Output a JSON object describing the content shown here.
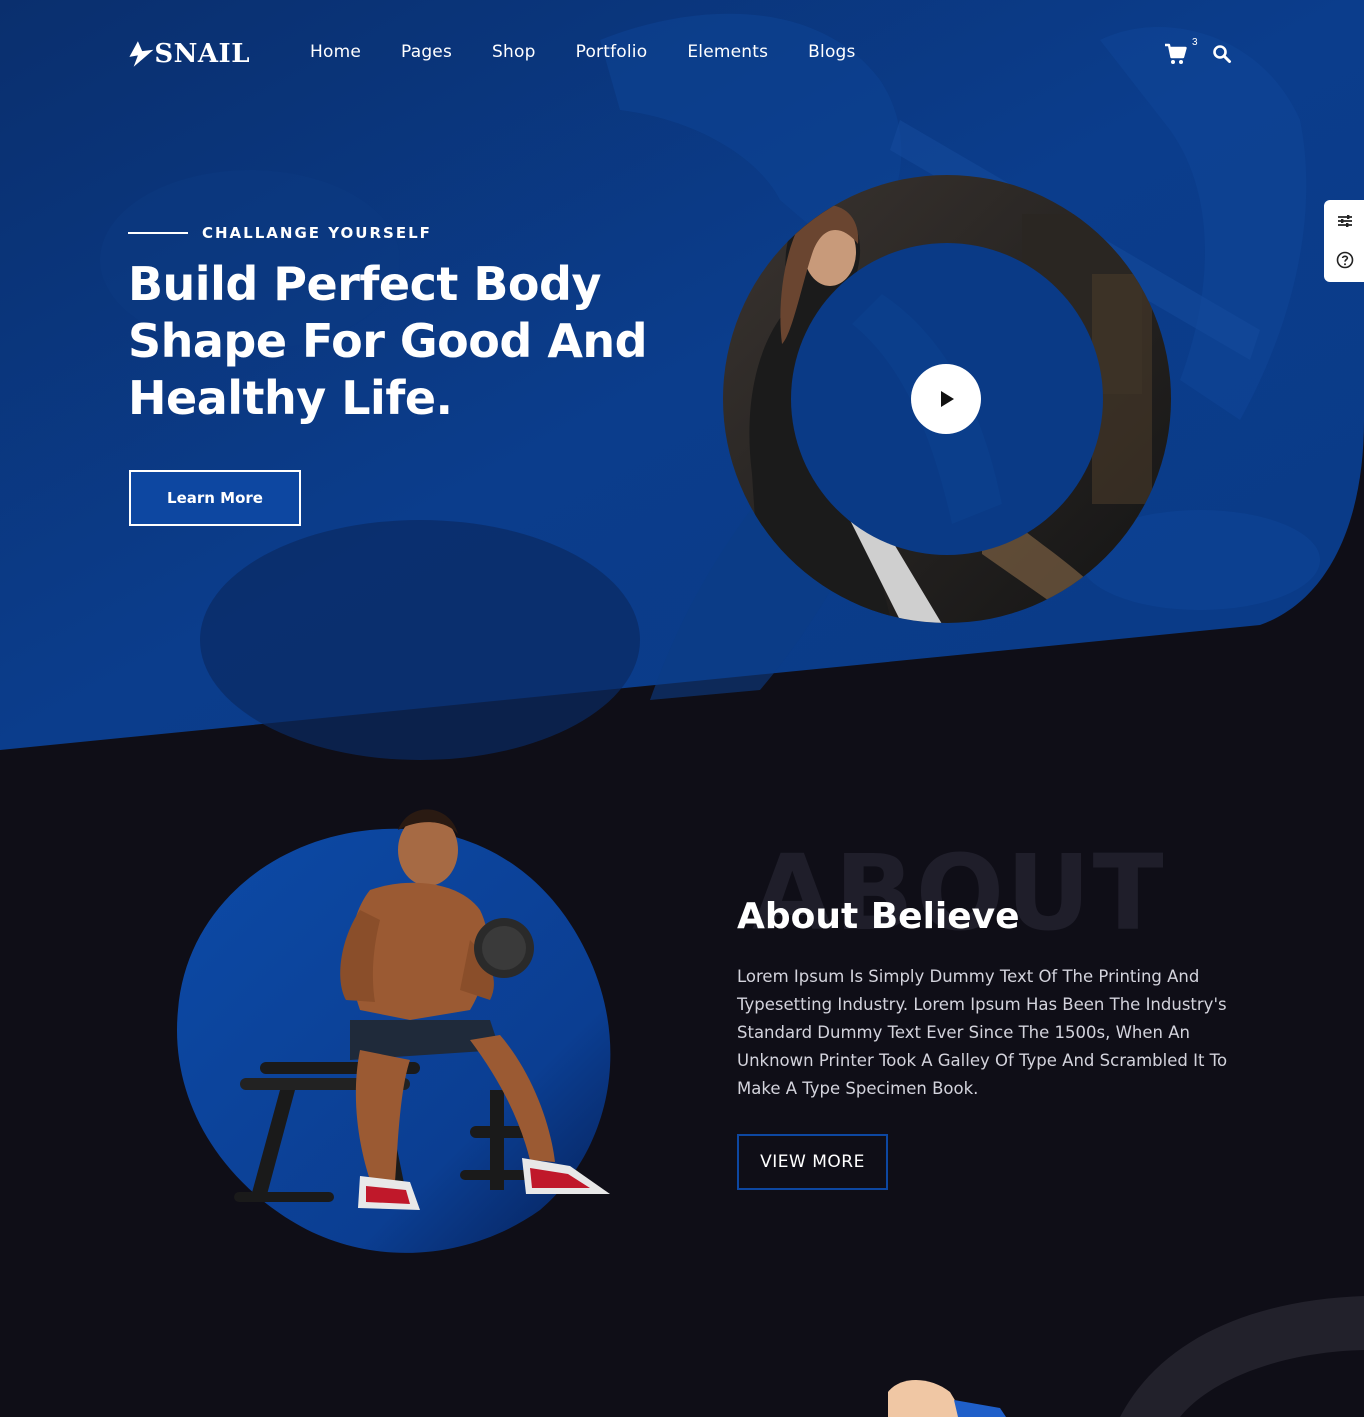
{
  "brand": {
    "name": "SNAIL"
  },
  "nav": {
    "items": [
      {
        "label": "Home"
      },
      {
        "label": "Pages"
      },
      {
        "label": "Shop"
      },
      {
        "label": "Portfolio"
      },
      {
        "label": "Elements"
      },
      {
        "label": "Blogs"
      }
    ],
    "cart_count": "3"
  },
  "hero": {
    "eyebrow": "CHALLANGE YOURSELF",
    "title": "Build Perfect Body Shape For Good And Healthy Life.",
    "cta": "Learn More"
  },
  "about": {
    "bg_word": "ABOUT",
    "title": "About Believe",
    "text": "Lorem Ipsum Is Simply Dummy Text Of The Printing And Typesetting Industry. Lorem Ipsum Has Been The Industry's Standard Dummy Text Ever Since The 1500s, When An Unknown Printer Took A Galley Of Type And Scrambled It To Make A Type Specimen Book.",
    "cta": "VIEW MORE"
  },
  "colors": {
    "primary": "#0d47a1",
    "background": "#0f0e17",
    "hero_blue": "#0a3a86"
  },
  "icons": [
    "logo-icon",
    "cart-icon",
    "search-icon",
    "sliders-icon",
    "help-icon",
    "play-icon"
  ]
}
